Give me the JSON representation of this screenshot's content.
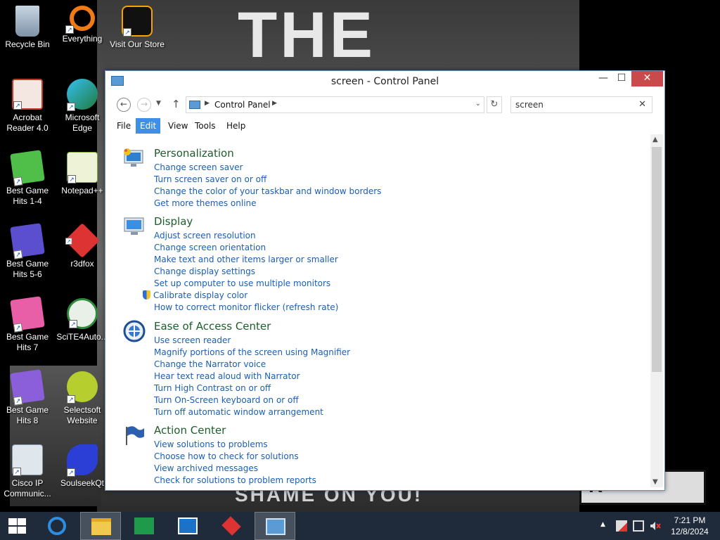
{
  "desktop": {
    "icons": [
      {
        "label": "Recycle Bin"
      },
      {
        "label": "Everything"
      },
      {
        "label": "Visit Our Store"
      },
      {
        "label": "Acrobat Reader 4.0"
      },
      {
        "label": "Microsoft Edge"
      },
      {
        "label": "Best Game Hits 1-4"
      },
      {
        "label": "Notepad++"
      },
      {
        "label": "Best Game Hits 5-6"
      },
      {
        "label": "r3dfox"
      },
      {
        "label": "Best Game Hits 7"
      },
      {
        "label": "SciTE4Auto..."
      },
      {
        "label": "Best Game Hits 8"
      },
      {
        "label": "Selectsoft Website"
      },
      {
        "label": "Cisco IP Communic..."
      },
      {
        "label": "SoulseekQt"
      }
    ],
    "wallpaper": {
      "title": "THE ROOM",
      "tagline": "SHAME ON YOU!",
      "corner_text": "R"
    }
  },
  "window": {
    "title": "screen - Control Panel",
    "min_label": "—",
    "max_label": "☐",
    "close_label": "✕",
    "address": {
      "crumb": "Control Panel"
    },
    "search": {
      "value": "screen"
    },
    "menu": [
      "File",
      "Edit",
      "View",
      "Tools",
      "Help"
    ],
    "sections": [
      {
        "title": "Personalization",
        "links": [
          "Change screen saver",
          "Turn screen saver on or off",
          "Change the color of your taskbar and window borders",
          "Get more themes online"
        ]
      },
      {
        "title": "Display",
        "links": [
          "Adjust screen resolution",
          "Change screen orientation",
          "Make text and other items larger or smaller",
          "Change display settings",
          "Set up computer to use multiple monitors",
          "Calibrate display color",
          "How to correct monitor flicker (refresh rate)"
        ]
      },
      {
        "title": "Ease of Access Center",
        "links": [
          "Use screen reader",
          "Magnify portions of the screen using Magnifier",
          "Change the Narrator voice",
          "Hear text read aloud with Narrator",
          "Turn High Contrast on or off",
          "Turn On-Screen keyboard on or off",
          "Turn off automatic window arrangement"
        ]
      },
      {
        "title": "Action Center",
        "links": [
          "View solutions to problems",
          "Choose how to check for solutions",
          "View archived messages",
          "Check for solutions to problem reports"
        ]
      }
    ]
  },
  "taskbar": {
    "time": "7:21 PM",
    "date": "12/8/2024"
  },
  "colors": {
    "link": "#1a5fb4",
    "section_title": "#1e5d2c",
    "menu_active": "#3e8fe8",
    "close_button": "#c94a4a",
    "taskbar": "#1f2a3a"
  }
}
